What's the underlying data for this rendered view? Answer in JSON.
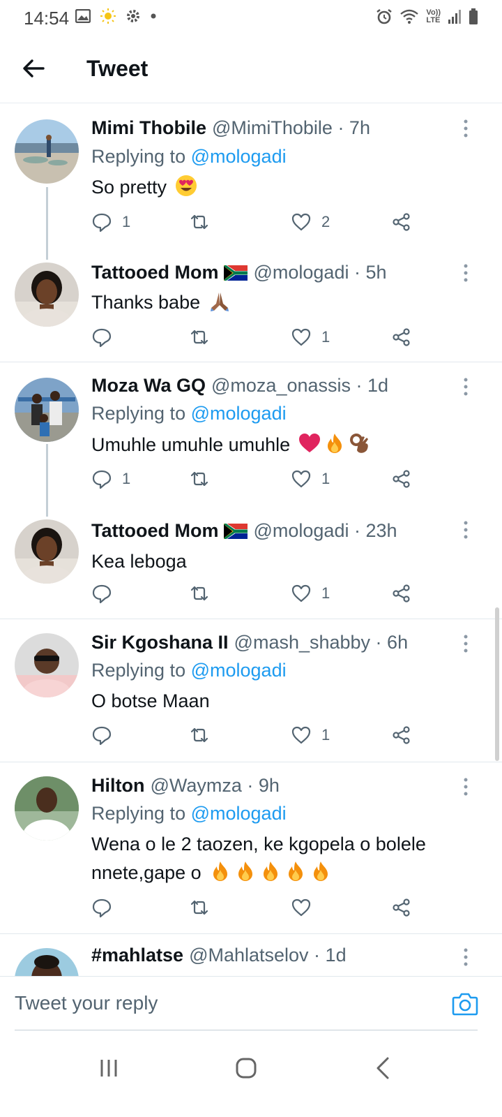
{
  "status_bar": {
    "time": "14:54",
    "left_icons": [
      "gallery-icon",
      "sun-icon",
      "gear-icon",
      "dot-icon"
    ],
    "right_icons": [
      "alarm-icon",
      "wifi-icon",
      "volte-icon",
      "signal-icon",
      "battery-icon"
    ],
    "volte_top": "Vo))",
    "volte_bottom": "LTE"
  },
  "header": {
    "title": "Tweet",
    "back_icon": "arrow-left-icon"
  },
  "tweets": [
    {
      "name": "Mimi Thobile",
      "handle": "@MimiThobile · 7h",
      "replying_prefix": "Replying to",
      "replying_to": "@mologadi",
      "text": "So pretty",
      "emojis": [
        "heart-eyes"
      ],
      "replies": "1",
      "retweets": "",
      "likes": "2"
    },
    {
      "name": "Tattooed Mom",
      "flag": "south-africa",
      "handle": "@mologadi · 5h",
      "text": "Thanks babe",
      "emojis": [
        "folded-hands"
      ],
      "replies": "",
      "retweets": "",
      "likes": "1"
    },
    {
      "name": "Moza Wa GQ",
      "handle": "@moza_onassis · 1d",
      "replying_prefix": "Replying to",
      "replying_to": "@mologadi",
      "text": "Umuhle umuhle umuhle",
      "emojis": [
        "red-heart",
        "fire",
        "ok-hand"
      ],
      "replies": "1",
      "retweets": "",
      "likes": "1"
    },
    {
      "name": "Tattooed Mom",
      "flag": "south-africa",
      "handle": "@mologadi · 23h",
      "text": "Kea leboga",
      "replies": "",
      "retweets": "",
      "likes": "1"
    },
    {
      "name": "Sir Kgoshana II",
      "handle": "@mash_shabby · 6h",
      "replying_prefix": "Replying to",
      "replying_to": "@mologadi",
      "text": "O botse Maan",
      "replies": "",
      "retweets": "",
      "likes": "1"
    },
    {
      "name": "Hilton",
      "handle": "@Waymza · 9h",
      "replying_prefix": "Replying to",
      "replying_to": "@mologadi",
      "text_line1": "Wena o le 2 taozen, ke kgopela o bolele",
      "text_line2": "nnete,gape o",
      "emojis": [
        "fire",
        "fire",
        "fire",
        "fire",
        "fire"
      ],
      "replies": "",
      "retweets": "",
      "likes": ""
    },
    {
      "name": "#mahlatse",
      "handle": "@Mahlatselov · 1d"
    }
  ],
  "reply_bar": {
    "placeholder": "Tweet your reply",
    "camera_icon": "camera-icon"
  },
  "nav_bar": {
    "icons": [
      "recents-icon",
      "home-icon",
      "back-icon"
    ]
  },
  "colors": {
    "accent": "#1d9bf0",
    "text": "#0f1419",
    "secondary": "#536471",
    "divider": "#e1e8ed"
  }
}
